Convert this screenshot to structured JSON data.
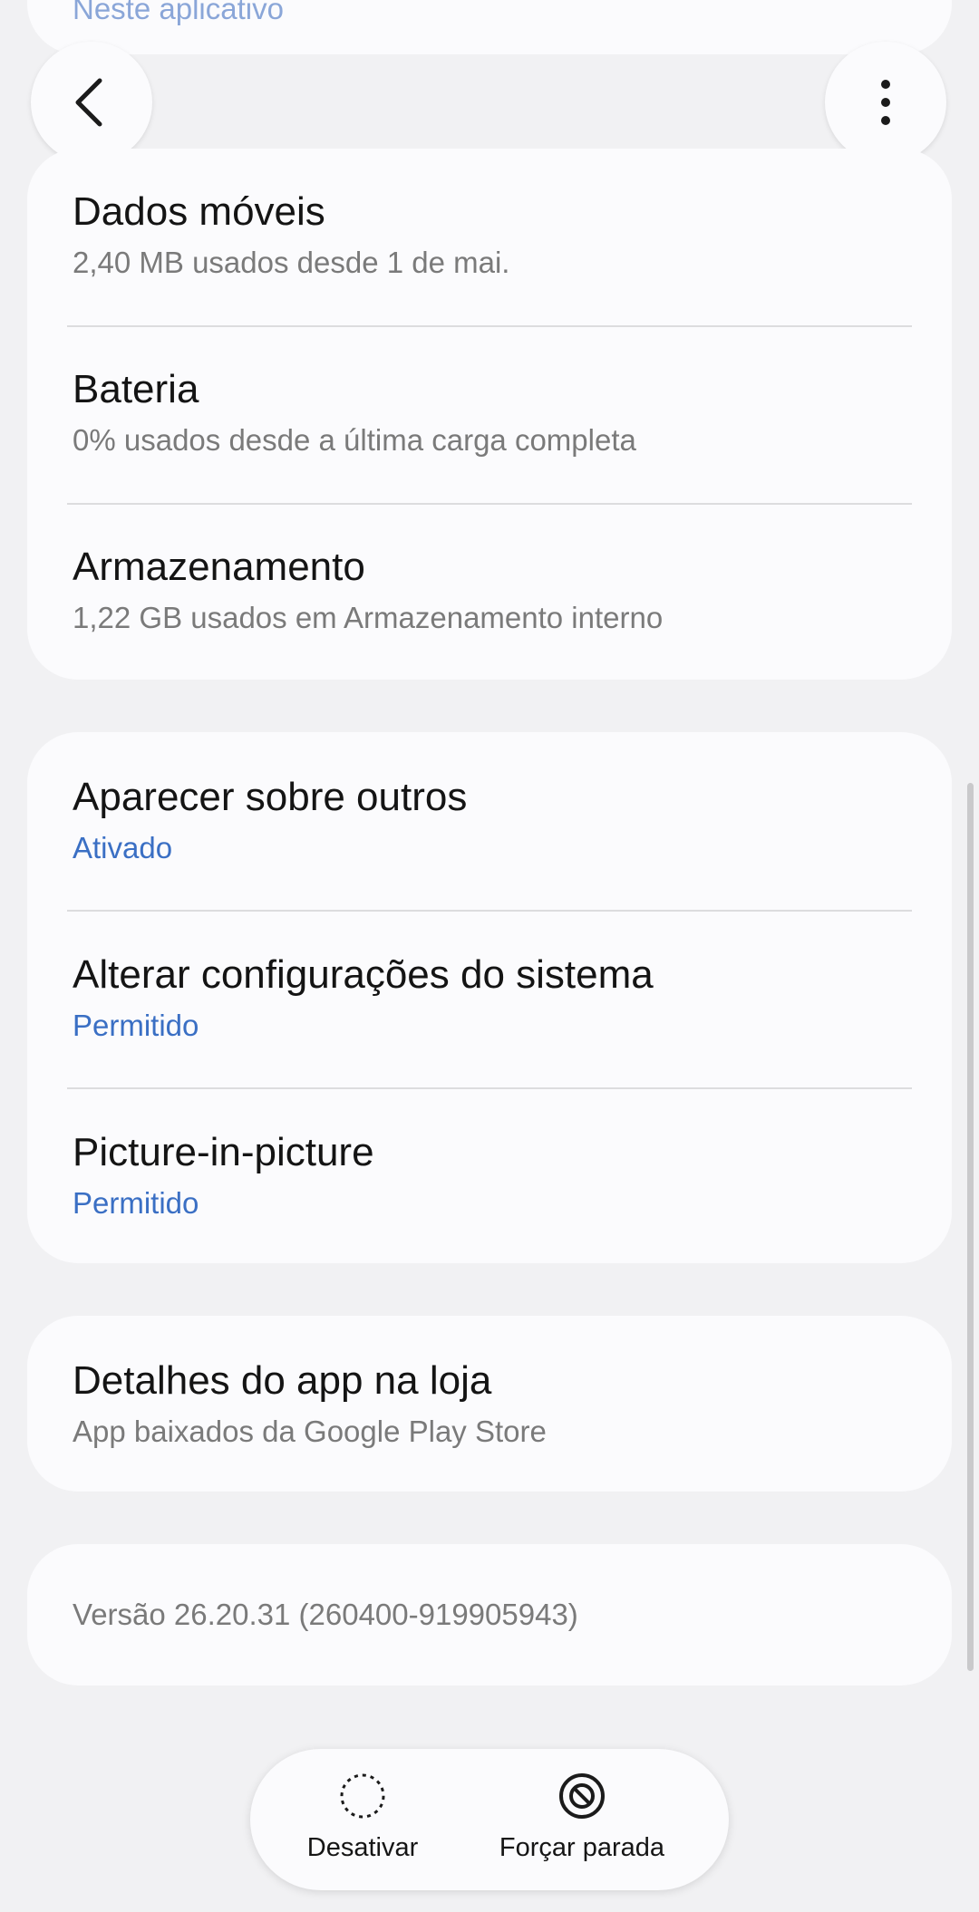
{
  "top_partial": {
    "text": "Neste aplicativo"
  },
  "header": {
    "back_icon": "chevron-left-icon",
    "more_icon": "more-vert-icon"
  },
  "usage": [
    {
      "title": "Dados móveis",
      "sub": "2,40 MB usados desde 1 de mai."
    },
    {
      "title": "Bateria",
      "sub": "0% usados desde a última carga completa"
    },
    {
      "title": "Armazenamento",
      "sub": "1,22 GB usados em Armazenamento interno"
    }
  ],
  "permissions": [
    {
      "title": "Aparecer sobre outros",
      "sub": "Ativado"
    },
    {
      "title": "Alterar configurações do sistema",
      "sub": "Permitido"
    },
    {
      "title": "Picture-in-picture",
      "sub": "Permitido"
    }
  ],
  "store": {
    "title": "Detalhes do app na loja",
    "sub": "App baixados da Google Play Store"
  },
  "version": {
    "text": "Versão 26.20.31 (260400-919905943)"
  },
  "actions": {
    "disable_label": "Desativar",
    "force_stop_label": "Forçar parada"
  },
  "colors": {
    "accent_blue": "#3a6fc4",
    "background": "#f1f1f3",
    "card": "#fbfbfd"
  }
}
